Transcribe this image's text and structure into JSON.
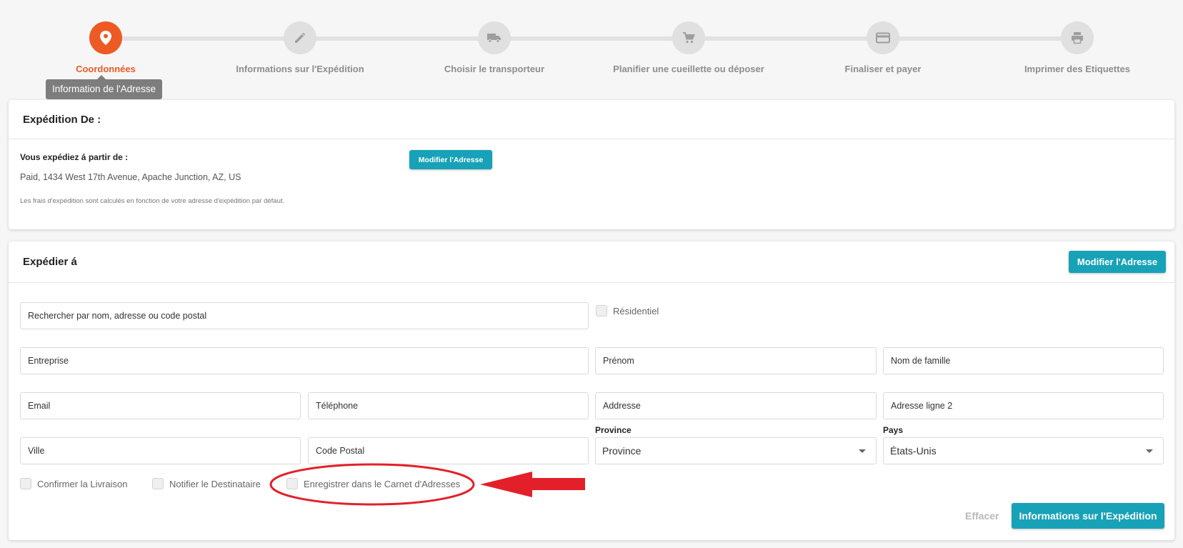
{
  "stepper": {
    "steps": [
      {
        "label": "Coordonnées",
        "icon": "location-pin-icon",
        "active": true
      },
      {
        "label": "Informations sur l'Expédition",
        "icon": "pencil-icon",
        "active": false
      },
      {
        "label": "Choisir le transporteur",
        "icon": "truck-icon",
        "active": false
      },
      {
        "label": "Planifier une cueillette ou déposer",
        "icon": "cart-icon",
        "active": false
      },
      {
        "label": "Finaliser et payer",
        "icon": "credit-card-icon",
        "active": false
      },
      {
        "label": "Imprimer des Etiquettes",
        "icon": "printer-icon",
        "active": false
      }
    ],
    "tooltip": "Information de l'Adresse"
  },
  "ship_from": {
    "title": "Expédition De :",
    "from_label": "Vous expédiez á partir de :",
    "address": "Paid, 1434 West 17th Avenue, Apache Junction, AZ, US",
    "note": "Les frais d'expédition sont calculés en fonction de votre adresse d'expédition par défaut.",
    "modify_button": "Modifier l'Adresse"
  },
  "ship_to": {
    "title": "Expédier á",
    "modify_button": "Modifier l'Adresse",
    "search_placeholder": "Rechercher par nom, adresse ou code postal",
    "residential_label": "Résidentiel",
    "fields": {
      "company": "Entreprise",
      "first_name": "Prénom",
      "last_name": "Nom de famille",
      "email": "Email",
      "phone": "Téléphone",
      "address": "Addresse",
      "address2": "Adresse ligne 2",
      "city": "Ville",
      "postal_code": "Code Postal"
    },
    "province": {
      "label": "Province",
      "value": "Province"
    },
    "country": {
      "label": "Pays",
      "value": "États-Unis"
    },
    "checkboxes": {
      "confirm_delivery": "Confirmer la Livraison",
      "notify_recipient": "Notifier le Destinataire",
      "save_address_book": "Enregistrer dans le Carnet d'Adresses"
    },
    "clear_button": "Effacer",
    "next_button": "Informations sur l'Expédition"
  },
  "colors": {
    "accent": "#ee5a24",
    "teal": "#17a2b8",
    "annotation_red": "#e3202a"
  }
}
